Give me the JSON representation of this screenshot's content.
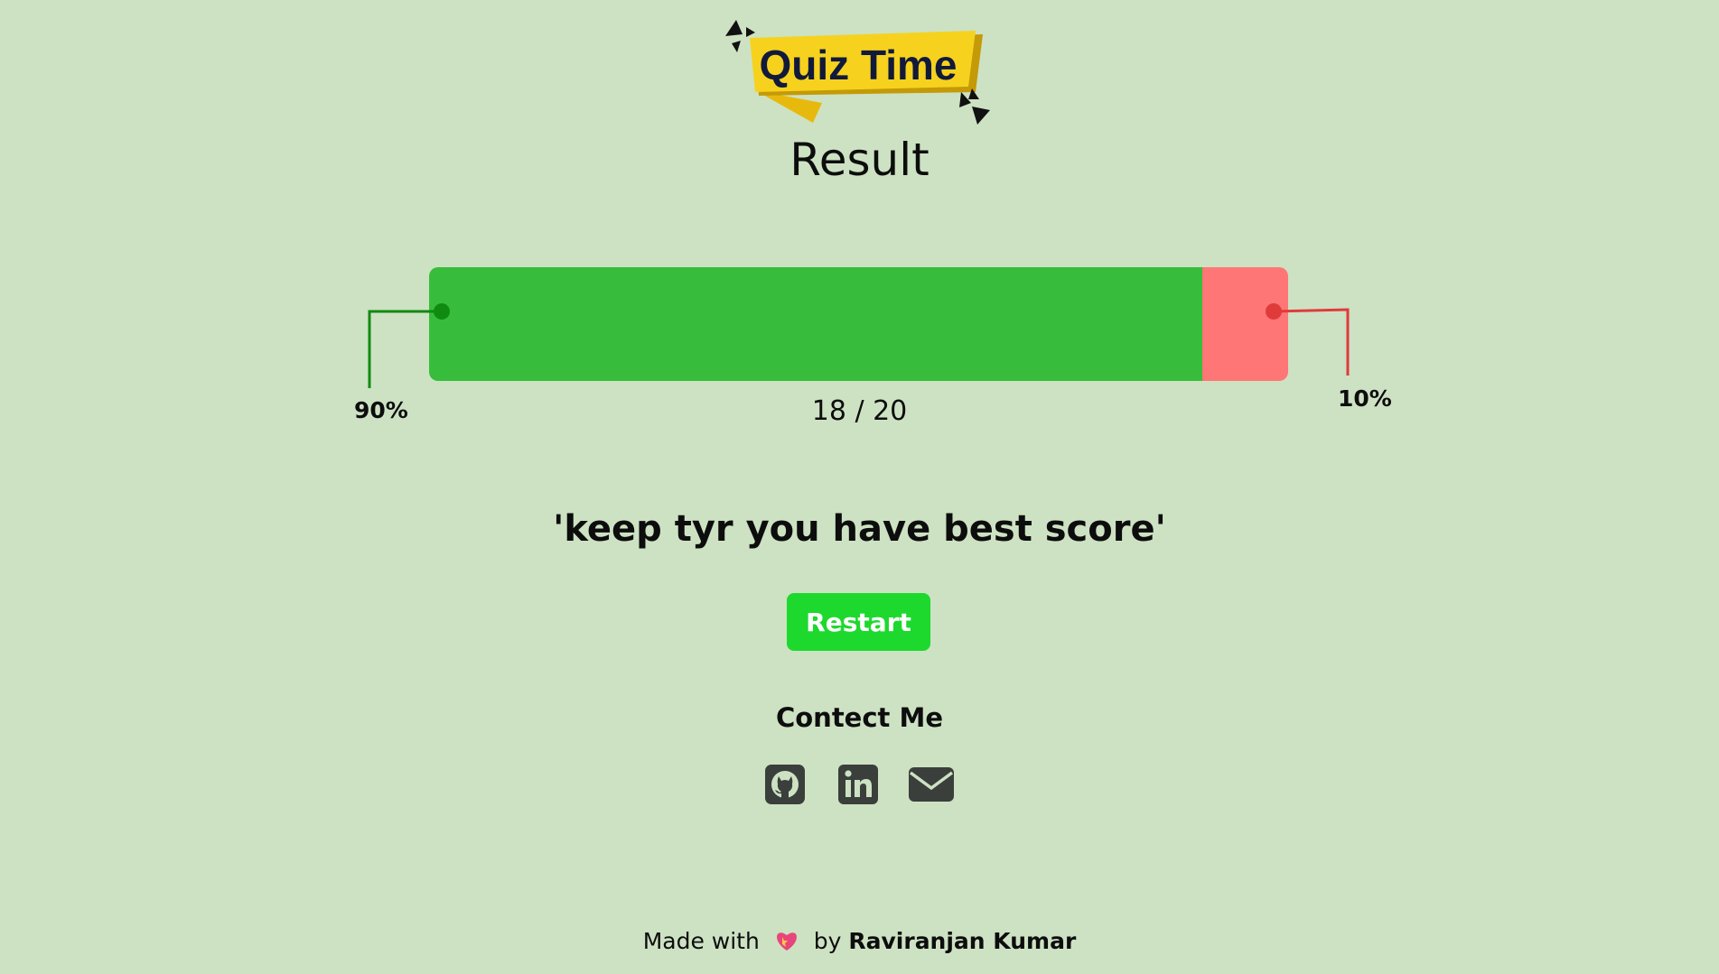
{
  "logo": {
    "text": "Quiz Time"
  },
  "page_title": "Result",
  "result": {
    "correct_fraction": 0.9,
    "correct_percent_label": "90%",
    "wrong_percent_label": "10%",
    "score_text": "18 / 20",
    "message": "'keep tyr you have best score'"
  },
  "restart_label": "Restart",
  "contact": {
    "title": "Contect Me",
    "icons": [
      "github-icon",
      "linkedin-icon",
      "mail-icon"
    ]
  },
  "footer": {
    "made_with": "Made with",
    "by": "by",
    "author": "Raviranjan Kumar"
  },
  "colors": {
    "background": "#cde2c3",
    "correct": "#37bd3b",
    "wrong": "#ff7676",
    "button": "#1dd92d",
    "logo_yellow": "#f6d21e",
    "icon": "#3b3f3b"
  }
}
